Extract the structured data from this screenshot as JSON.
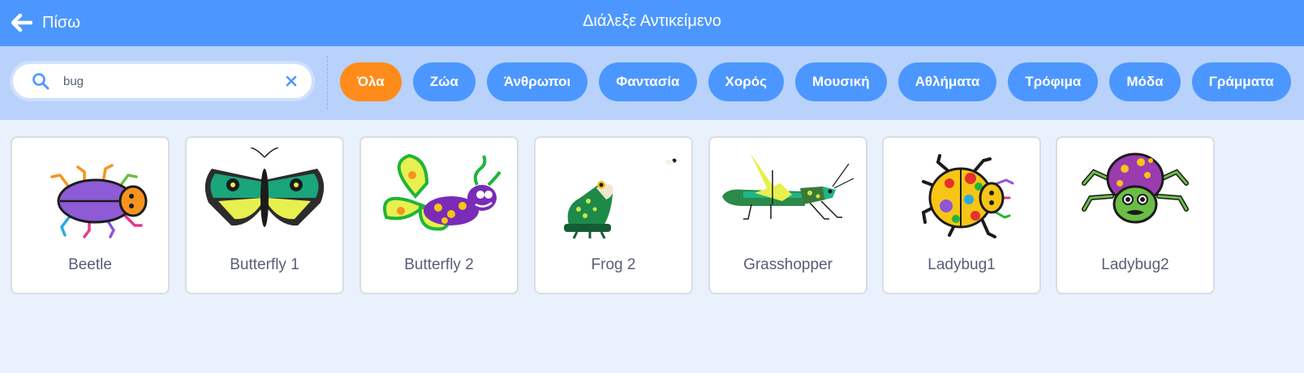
{
  "header": {
    "back_label": "Πίσω",
    "title": "Διάλεξε Αντικείμενο"
  },
  "search": {
    "value": "bug"
  },
  "tags": [
    {
      "label": "Όλα",
      "active": true
    },
    {
      "label": "Ζώα",
      "active": false
    },
    {
      "label": "Άνθρωποι",
      "active": false
    },
    {
      "label": "Φαντασία",
      "active": false
    },
    {
      "label": "Χορός",
      "active": false
    },
    {
      "label": "Μουσική",
      "active": false
    },
    {
      "label": "Αθλήματα",
      "active": false
    },
    {
      "label": "Τρόφιμα",
      "active": false
    },
    {
      "label": "Μόδα",
      "active": false
    },
    {
      "label": "Γράμματα",
      "active": false
    }
  ],
  "colors": {
    "header": "#4c97ff",
    "filter_bar": "#b8d2fb",
    "active_tag": "#ff8c1a",
    "page_bg": "#e9f1fc",
    "card_text": "#575e75"
  },
  "sprites": [
    {
      "name": "Beetle",
      "icon": "beetle-icon"
    },
    {
      "name": "Butterfly 1",
      "icon": "butterfly-icon"
    },
    {
      "name": "Butterfly 2",
      "icon": "butterfly-caterpillar-icon"
    },
    {
      "name": "Frog 2",
      "icon": "frog-icon"
    },
    {
      "name": "Grasshopper",
      "icon": "grasshopper-icon"
    },
    {
      "name": "Ladybug1",
      "icon": "ladybug-icon"
    },
    {
      "name": "Ladybug2",
      "icon": "spider-ladybug-icon"
    }
  ]
}
